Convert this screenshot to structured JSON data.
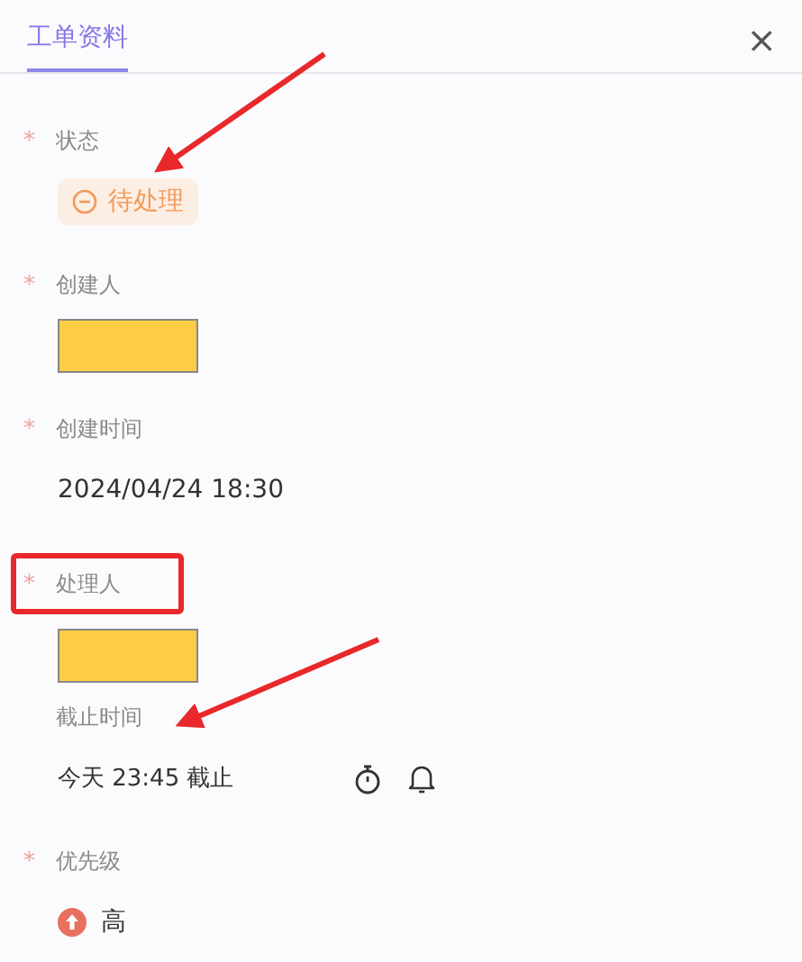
{
  "tab": {
    "label": "工单资料",
    "selected": true
  },
  "close": "×",
  "fields": [
    {
      "kind": "status",
      "mark": "*",
      "label": "状态",
      "highlighted": false,
      "value": "待处理"
    },
    {
      "kind": "redacted",
      "mark": "*",
      "label": "创建人",
      "highlighted": false
    },
    {
      "kind": "text",
      "mark": "*",
      "label": "创建时间",
      "highlighted": false,
      "value": "2024/04/24 18:30"
    },
    {
      "kind": "redacted",
      "mark": "*",
      "label": "处理人",
      "highlighted": true
    },
    {
      "kind": "deadline",
      "label": "截止时间",
      "highlighted": false,
      "value": "今天 23:45 截止"
    },
    {
      "kind": "priority",
      "mark": "*",
      "label": "优先级",
      "highlighted": false,
      "value": "高"
    }
  ]
}
